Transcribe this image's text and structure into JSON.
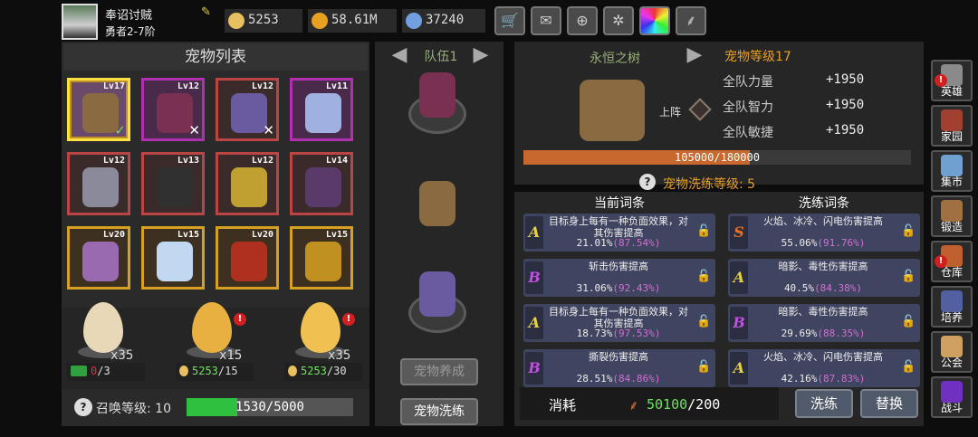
{
  "player": {
    "name": "奉诏讨贼",
    "rank": "勇者2-7阶"
  },
  "resources": [
    {
      "name": "egg",
      "value": "5253",
      "color": "#e8c060"
    },
    {
      "name": "coin",
      "value": "58.61M",
      "color": "#e8a020"
    },
    {
      "name": "gem",
      "value": "37240",
      "color": "#70a0e0"
    }
  ],
  "toolbar": [
    "shop-icon",
    "mail-icon",
    "gamepad-icon",
    "settings-icon",
    "color-wheel-icon",
    "feather-icon"
  ],
  "pet_list": {
    "title": "宠物列表",
    "pets": [
      {
        "level": "Lv17",
        "frame": "sel",
        "mark": "✓",
        "mark_color": "#70e060",
        "color": "#8a6a40"
      },
      {
        "level": "Lv12",
        "frame": "pur",
        "mark": "✕",
        "mark_color": "#ffffff",
        "color": "#7a3050"
      },
      {
        "level": "Lv12",
        "frame": "red",
        "mark": "✕",
        "mark_color": "#ffffff",
        "color": "#6a5aa0"
      },
      {
        "level": "Lv11",
        "frame": "pur",
        "mark": "",
        "mark_color": "",
        "color": "#a0b0e0"
      },
      {
        "level": "Lv12",
        "frame": "red",
        "mark": "",
        "mark_color": "",
        "color": "#8a8a9a"
      },
      {
        "level": "Lv13",
        "frame": "red",
        "mark": "",
        "mark_color": "",
        "color": "#303030"
      },
      {
        "level": "Lv12",
        "frame": "red",
        "mark": "",
        "mark_color": "",
        "color": "#c0a030"
      },
      {
        "level": "Lv14",
        "frame": "red",
        "mark": "",
        "mark_color": "",
        "color": "#5a3a6a"
      },
      {
        "level": "Lv20",
        "frame": "gold",
        "mark": "",
        "mark_color": "",
        "color": "#9a6ab0"
      },
      {
        "level": "Lv15",
        "frame": "gold",
        "mark": "",
        "mark_color": "",
        "color": "#c0d8f0"
      },
      {
        "level": "Lv20",
        "frame": "gold",
        "mark": "",
        "mark_color": "",
        "color": "#b03020"
      },
      {
        "level": "Lv15",
        "frame": "gold",
        "mark": "",
        "mark_color": "",
        "color": "#c09020"
      }
    ]
  },
  "eggs": [
    {
      "count": "x35",
      "cost_cur": "0",
      "cost_max": "/3",
      "cur_color": "#e03030",
      "egg_color": "#e8d8b8",
      "alert": false
    },
    {
      "count": "x15",
      "cost_cur": "5253",
      "cost_max": "/15",
      "cur_color": "#70e060",
      "egg_color": "#e8b040",
      "alert": true
    },
    {
      "count": "x35",
      "cost_cur": "5253",
      "cost_max": "/30",
      "cur_color": "#70e060",
      "egg_color": "#f0c050",
      "alert": true
    }
  ],
  "summon": {
    "label": "召唤等级: 10",
    "progress_text": "1530/5000",
    "progress": 0.306
  },
  "team": {
    "label": "队伍1"
  },
  "mid_buttons": {
    "cultivate": "宠物养成",
    "reroll": "宠物洗练"
  },
  "detail": {
    "name": "永恒之树",
    "level": "宠物等级17",
    "deploy": "上阵",
    "exp_text": "105000/180000",
    "exp_progress": 0.583,
    "stats": [
      {
        "label": "全队力量",
        "value": "+1950"
      },
      {
        "label": "全队智力",
        "value": "+1950"
      },
      {
        "label": "全队敏捷",
        "value": "+1950"
      }
    ]
  },
  "reroll": {
    "level_label": "宠物洗练等级: 5",
    "current_header": "当前词条",
    "new_header": "洗练词条",
    "current": [
      {
        "grade": "A",
        "grade_color": "#e8d040",
        "text": "目标身上每有一种负面效果，对其伤害提高",
        "base": "21.01%",
        "max": "(87.54%)"
      },
      {
        "grade": "B",
        "grade_color": "#c050e0",
        "text": "斩击伤害提高",
        "base": "31.06%",
        "max": "(92.43%)"
      },
      {
        "grade": "A",
        "grade_color": "#e8d040",
        "text": "目标身上每有一种负面效果，对其伤害提高",
        "base": "18.73%",
        "max": "(97.53%)"
      },
      {
        "grade": "B",
        "grade_color": "#c050e0",
        "text": "撕裂伤害提高",
        "base": "28.51%",
        "max": "(84.86%)"
      }
    ],
    "new": [
      {
        "grade": "S",
        "grade_color": "#e87020",
        "text": "火焰、冰冷、闪电伤害提高",
        "base": "55.06%",
        "max": "(91.76%)"
      },
      {
        "grade": "A",
        "grade_color": "#e8d040",
        "text": "暗影、毒性伤害提高",
        "base": "40.5%",
        "max": "(84.38%)"
      },
      {
        "grade": "B",
        "grade_color": "#c050e0",
        "text": "暗影、毒性伤害提高",
        "base": "29.69%",
        "max": "(88.35%)"
      },
      {
        "grade": "A",
        "grade_color": "#e8d040",
        "text": "火焰、冰冷、闪电伤害提高",
        "base": "42.16%",
        "max": "(87.83%)"
      }
    ],
    "cost_label": "消耗",
    "cost_value": "50100",
    "cost_need": "/200",
    "reroll_btn": "洗练",
    "replace_btn": "替换"
  },
  "side_menu": [
    {
      "label": "英雄",
      "alert": true,
      "color": "#8a8a8a"
    },
    {
      "label": "家园",
      "alert": false,
      "color": "#a04030"
    },
    {
      "label": "集市",
      "alert": false,
      "color": "#70a0d0"
    },
    {
      "label": "锻造",
      "alert": false,
      "color": "#a07040"
    },
    {
      "label": "仓库",
      "alert": true,
      "color": "#c06030"
    },
    {
      "label": "培养",
      "alert": false,
      "color": "#5060a0"
    },
    {
      "label": "公会",
      "alert": false,
      "color": "#d0a060"
    },
    {
      "label": "战斗",
      "alert": false,
      "color": "#7030c0"
    }
  ]
}
